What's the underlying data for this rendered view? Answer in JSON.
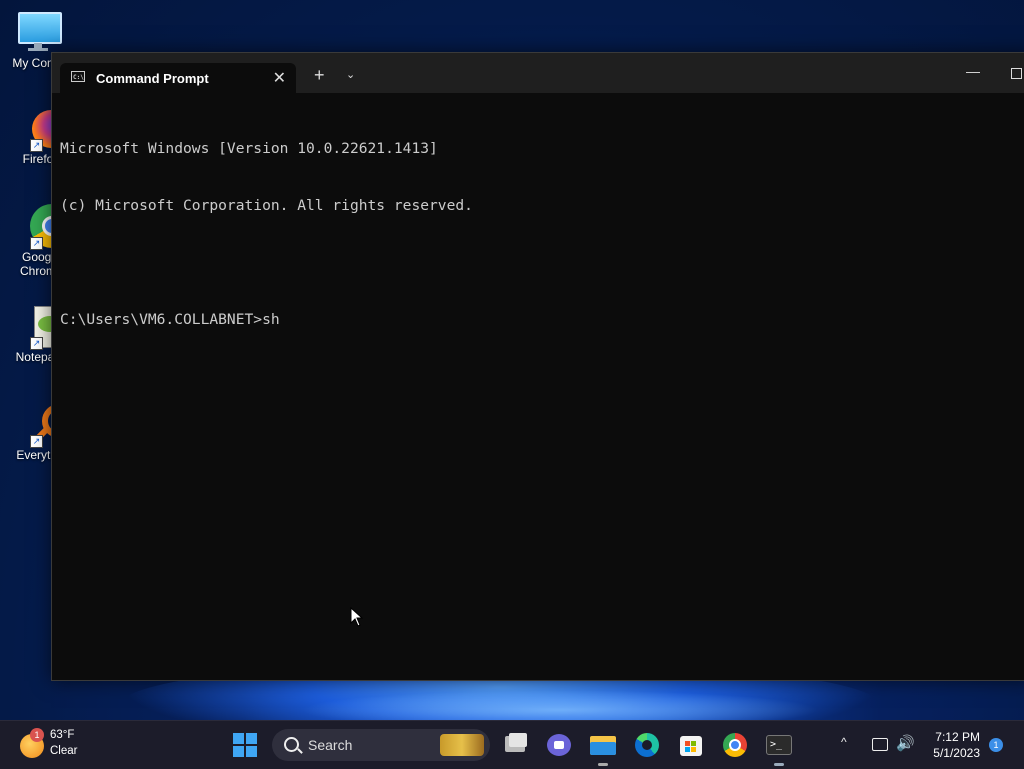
{
  "desktop": {
    "icons": [
      {
        "label": "My Comp"
      },
      {
        "label": "Firefo"
      },
      {
        "label": "Googl\nChrom"
      },
      {
        "label": "Notepac"
      },
      {
        "label": "Everythi"
      }
    ]
  },
  "window": {
    "tab_title": "Command Prompt",
    "tab_close": "✕",
    "new_tab": "+",
    "tab_dropdown": "⌄",
    "minimize": "—"
  },
  "console": {
    "lines": [
      "Microsoft Windows [Version 10.0.22621.1413]",
      "(c) Microsoft Corporation. All rights reserved.",
      "",
      "C:\\Users\\VM6.COLLABNET>sh"
    ]
  },
  "taskbar": {
    "weather": {
      "badge": "1",
      "temp": "63°F",
      "condition": "Clear"
    },
    "search_label": "Search",
    "apps": [
      "task-view",
      "teams-chat",
      "file-explorer",
      "edge",
      "microsoft-store",
      "chrome",
      "terminal"
    ],
    "tray_up": "^",
    "volume": "🔊",
    "clock": {
      "time": "7:12 PM",
      "date": "5/1/2023"
    },
    "notification_count": "1"
  },
  "colors": {
    "console_bg": "#0c0c0c",
    "console_fg": "#cccccc",
    "accent": "#3fa6f4"
  }
}
